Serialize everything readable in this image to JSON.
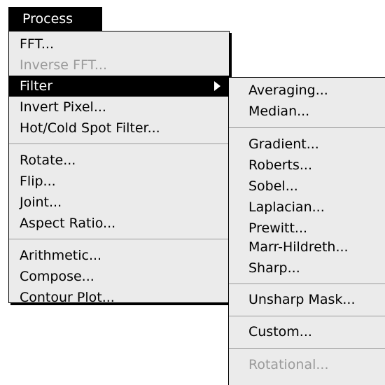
{
  "menubar": {
    "title": "Process"
  },
  "main_menu": {
    "items": [
      {
        "label": "FFT...",
        "enabled": true
      },
      {
        "label": "Inverse FFT...",
        "enabled": false
      },
      {
        "label": "Filter",
        "enabled": true,
        "selected": true,
        "has_submenu": true
      },
      {
        "label": "Invert Pixel...",
        "enabled": true
      },
      {
        "label": "Hot/Cold Spot Filter...",
        "enabled": true
      },
      {
        "label": "Rotate...",
        "enabled": true
      },
      {
        "label": "Flip...",
        "enabled": true
      },
      {
        "label": "Joint...",
        "enabled": true
      },
      {
        "label": "Aspect Ratio...",
        "enabled": true
      },
      {
        "label": "Arithmetic...",
        "enabled": true
      },
      {
        "label": "Compose...",
        "enabled": true
      },
      {
        "label": "Contour Plot...",
        "enabled": true
      }
    ]
  },
  "filter_submenu": {
    "items": [
      {
        "label": "Averaging...",
        "enabled": true
      },
      {
        "label": "Median...",
        "enabled": true
      },
      {
        "label": "Gradient...",
        "enabled": true
      },
      {
        "label": "Roberts...",
        "enabled": true
      },
      {
        "label": "Sobel...",
        "enabled": true
      },
      {
        "label": "Laplacian...",
        "enabled": true
      },
      {
        "label": "Prewitt...",
        "enabled": true
      },
      {
        "label": "Marr-Hildreth...",
        "enabled": true
      },
      {
        "label": "Sharp...",
        "enabled": true
      },
      {
        "label": "Unsharp Mask...",
        "enabled": true
      },
      {
        "label": "Custom...",
        "enabled": true
      },
      {
        "label": "Rotational...",
        "enabled": false
      }
    ]
  }
}
